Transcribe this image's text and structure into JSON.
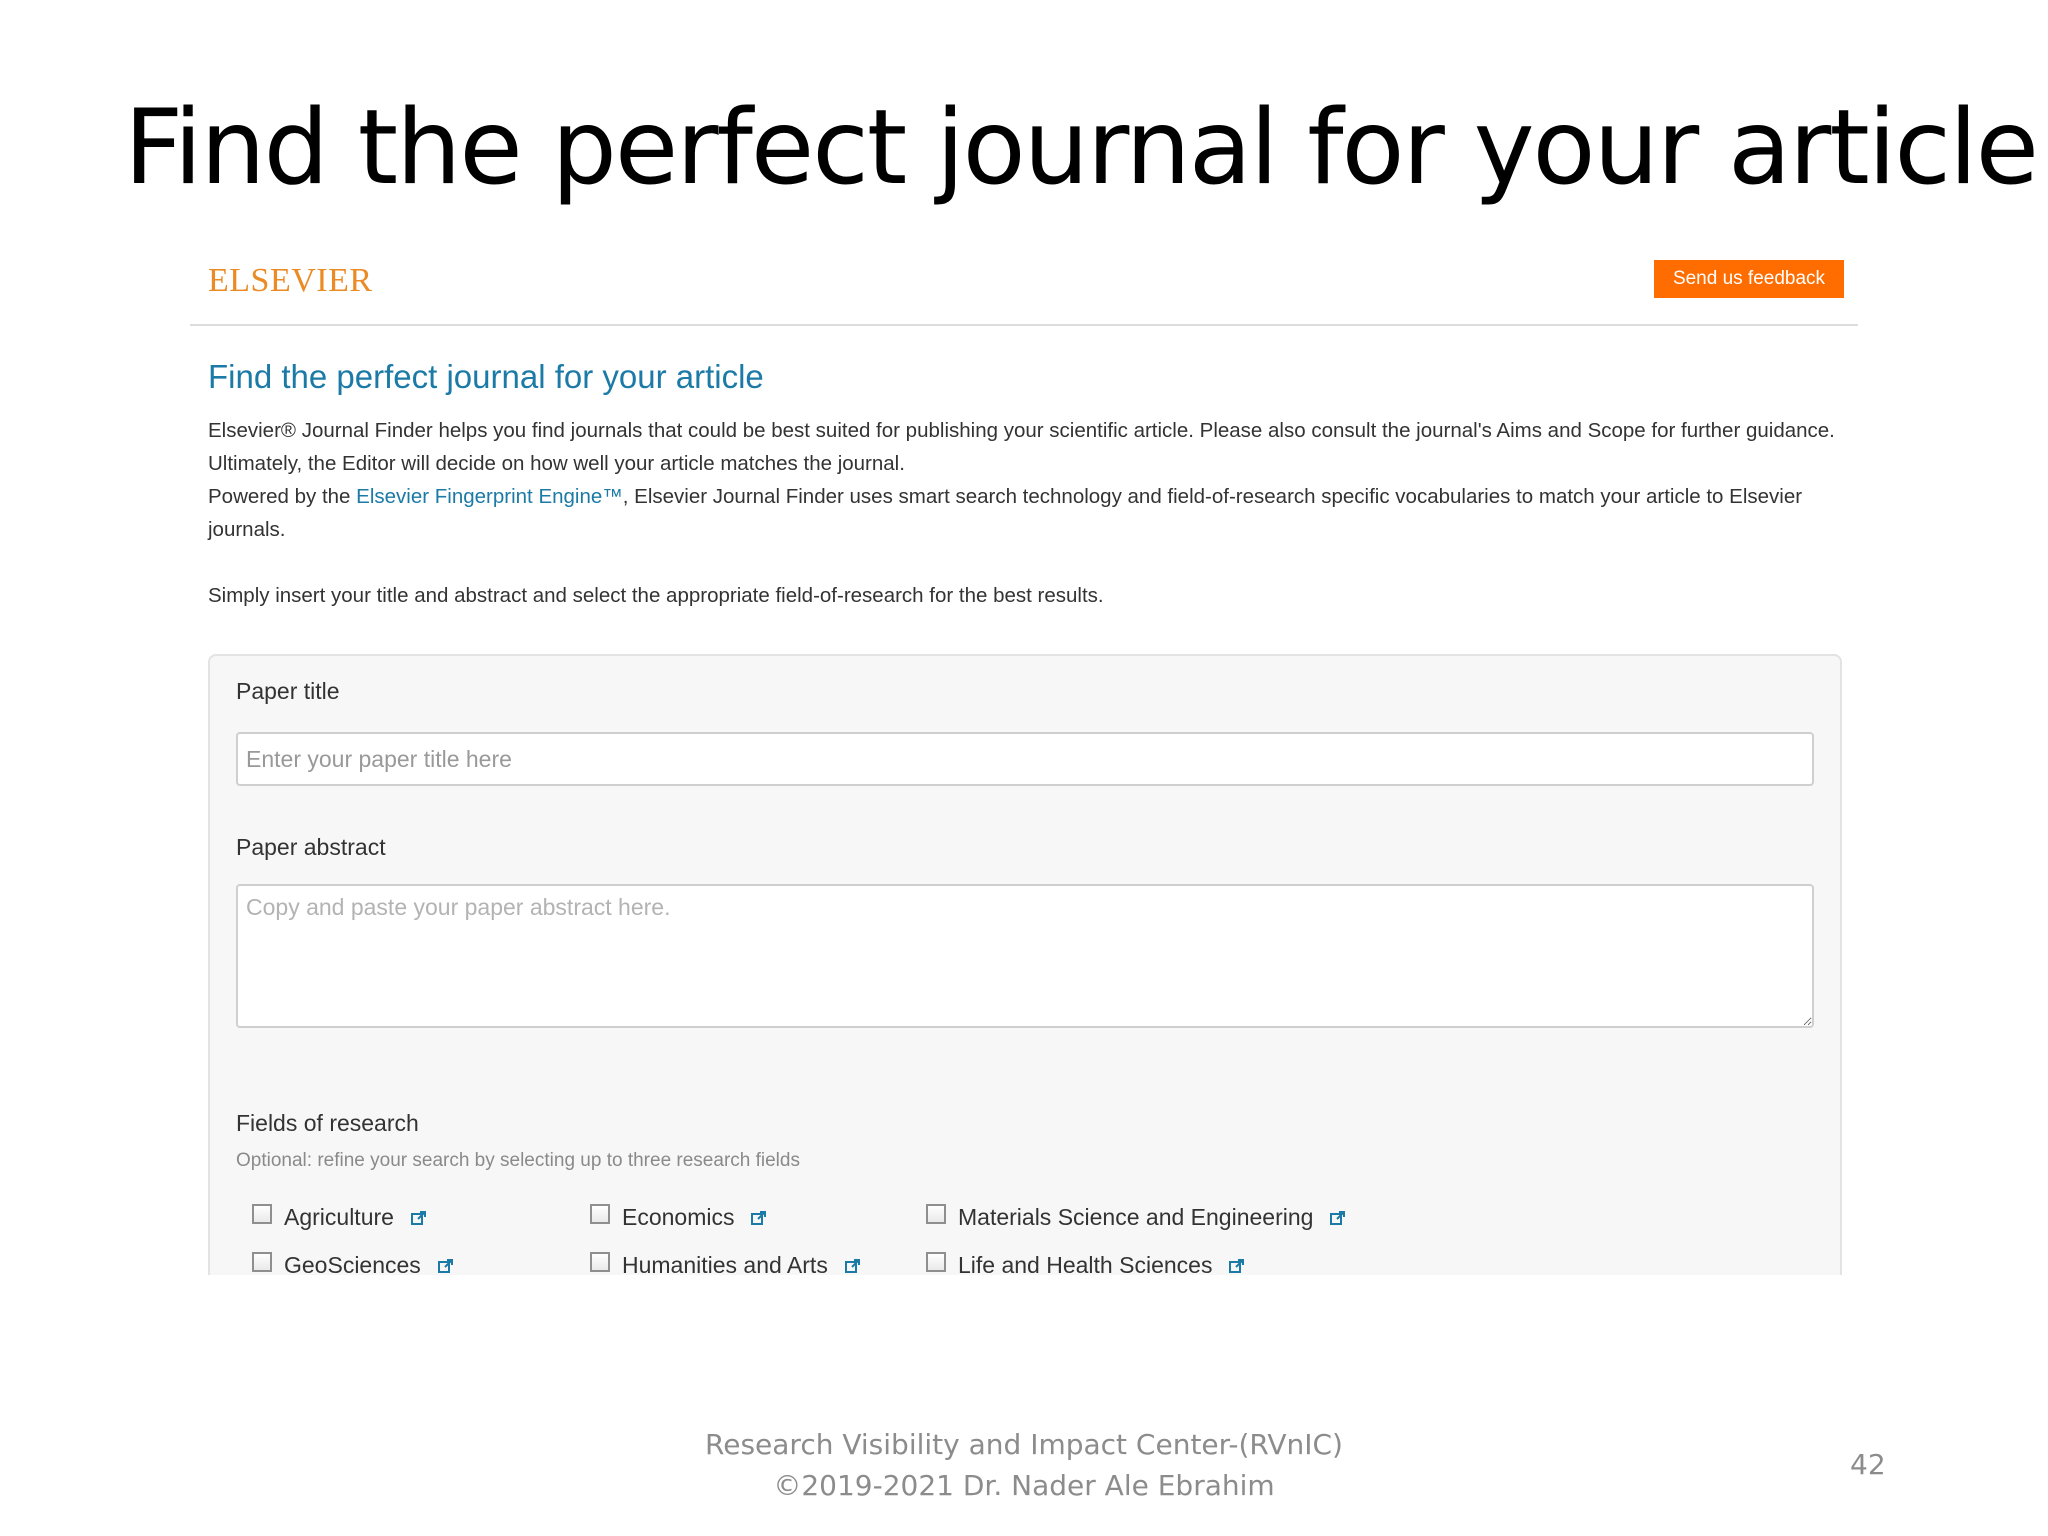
{
  "slide": {
    "title": "Find the perfect journal for your article",
    "footer_line1": "Research Visibility and Impact Center-(RVnIC)",
    "footer_line2": "©2019-2021 Dr. Nader Ale Ebrahim",
    "page_number": "42"
  },
  "app": {
    "logo_text": "ELSEVIER",
    "feedback_label": "Send us feedback",
    "heading": "Find the perfect journal for your article",
    "intro": {
      "p1": "Elsevier® Journal Finder helps you find journals that could be best suited for publishing your scientific article. Please also consult the journal's Aims and Scope for further guidance. Ultimately, the Editor will decide on how well your article matches the journal.",
      "p2_prefix": "Powered by the ",
      "p2_link": "Elsevier Fingerprint Engine™",
      "p2_suffix": ", Elsevier Journal Finder uses smart search technology and field-of-research specific vocabularies to match your article to Elsevier journals.",
      "p3": "Simply insert your title and abstract and select the appropriate field-of-research for the best results."
    },
    "form": {
      "title_label": "Paper title",
      "title_placeholder": "Enter your paper title here",
      "abstract_label": "Paper abstract",
      "abstract_placeholder": "Copy and paste your paper abstract here.",
      "fields_label": "Fields of research",
      "fields_hint": "Optional: refine your search by selecting up to three research fields",
      "fields": [
        {
          "label": "Agriculture",
          "checked": false
        },
        {
          "label": "Economics",
          "checked": false
        },
        {
          "label": "Materials Science and Engineering",
          "checked": false
        },
        {
          "label": "GeoSciences",
          "checked": false
        },
        {
          "label": "Humanities and Arts",
          "checked": false
        },
        {
          "label": "Life and Health Sciences",
          "checked": false
        }
      ]
    }
  },
  "colors": {
    "accent_link": "#1b7aa6",
    "logo": "#ea8b25",
    "feedback_button": "#ff6c00"
  },
  "icons": {
    "field_link": "external-link-icon"
  }
}
